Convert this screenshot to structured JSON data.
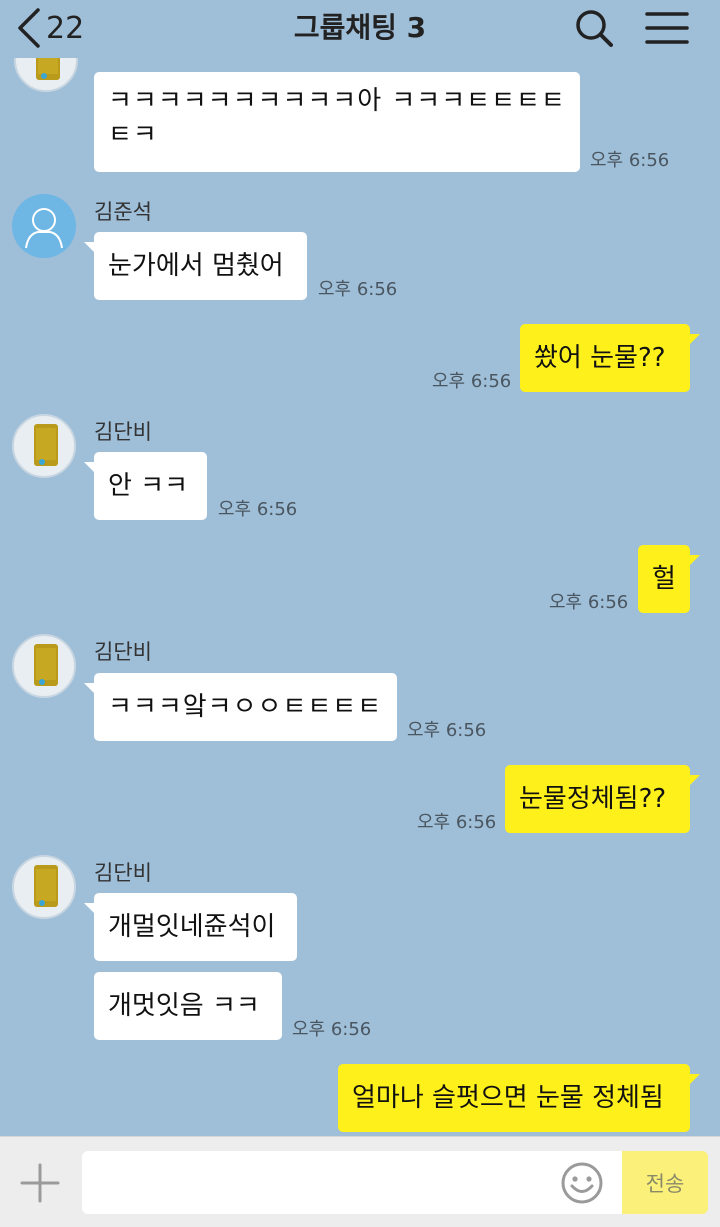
{
  "header": {
    "back_count": "22",
    "title": "그룹채팅 3"
  },
  "messages": [
    {
      "id": "m1",
      "side": "left",
      "sender": "",
      "avatar": "photo",
      "text": "ㅋㅋㅋㅋㅋㅋㅋㅋㅋㅋ아 ㅋㅋㅋㅌㅌㅌㅌ ㅌㅋ",
      "time": "오후 6:56"
    },
    {
      "id": "m2",
      "side": "left",
      "sender": "김준석",
      "avatar": "default",
      "text": "눈가에서 멈췄어",
      "time": "오후 6:56"
    },
    {
      "id": "m3",
      "side": "right",
      "text": "쐈어 눈물??",
      "time": "오후 6:56"
    },
    {
      "id": "m4",
      "side": "left",
      "sender": "김단비",
      "avatar": "photo",
      "text": "안 ㅋㅋ",
      "time": "오후 6:56"
    },
    {
      "id": "m5",
      "side": "right",
      "text": "헐",
      "time": "오후 6:56"
    },
    {
      "id": "m6",
      "side": "left",
      "sender": "김단비",
      "avatar": "photo",
      "text": "ㅋㅋㅋ앜ㅋㅇㅇㅌㅌㅌㅌ",
      "time": "오후 6:56"
    },
    {
      "id": "m7",
      "side": "right",
      "text": "눈물정체됨??",
      "time": "오후 6:56"
    },
    {
      "id": "m8",
      "side": "left",
      "sender": "김단비",
      "avatar": "photo",
      "text": "개멀잇네쥰석이",
      "time": ""
    },
    {
      "id": "m9",
      "side": "left",
      "text": "개멋잇음 ㅋㅋ",
      "time": "오후 6:56"
    },
    {
      "id": "m10",
      "side": "right",
      "text": "얼마나 슬펏으면 눈물 정체됨",
      "time": ""
    }
  ],
  "input_bar": {
    "placeholder": "",
    "send_label": "전송"
  },
  "icons": [
    "back-chevron-icon",
    "search-icon",
    "menu-icon",
    "plus-icon",
    "emoji-icon",
    "default-profile-icon"
  ],
  "colors": {
    "background": "#9fbed8",
    "my_bubble": "#fef01b",
    "other_bubble": "#ffffff",
    "send_button": "#fbf079"
  }
}
